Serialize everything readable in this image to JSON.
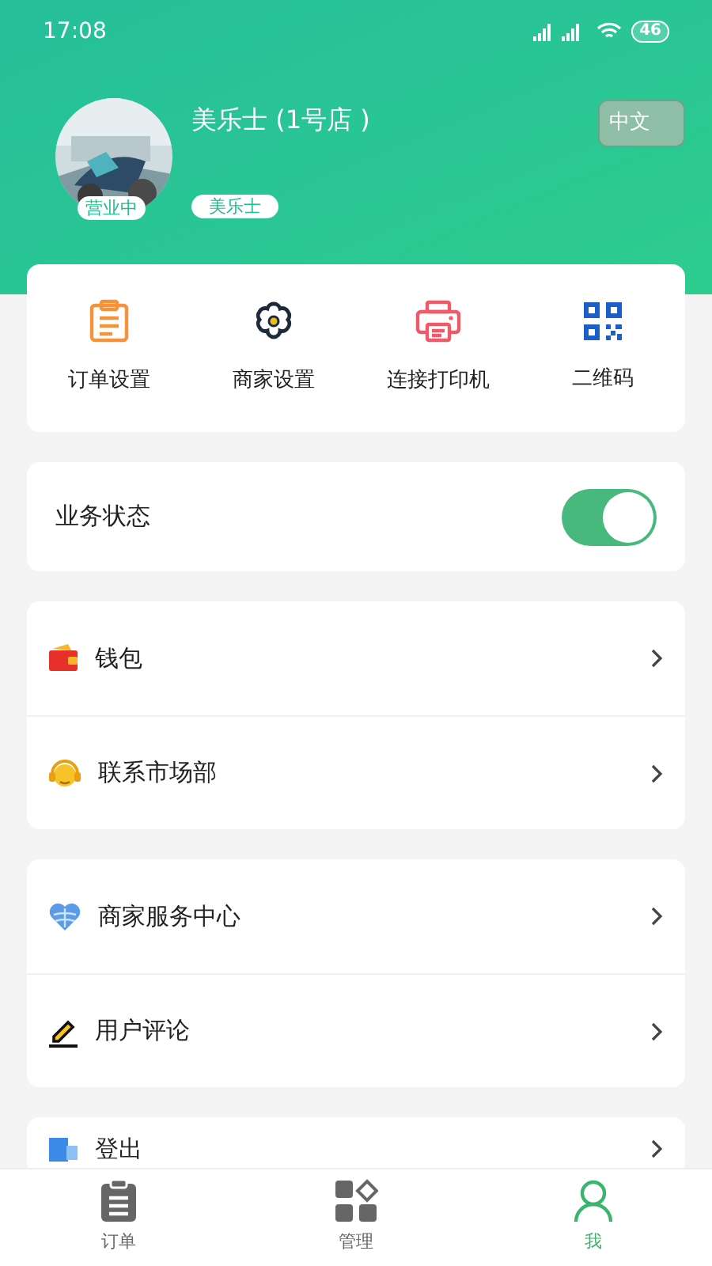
{
  "status_bar": {
    "time": "17:08",
    "battery": "46"
  },
  "profile": {
    "name": "美乐士 (1号店 )",
    "status_badge": "营业中",
    "tag": "美乐士",
    "language_button": "中文"
  },
  "shortcuts": [
    {
      "label": "订单设置"
    },
    {
      "label": "商家设置"
    },
    {
      "label": "连接打印机"
    },
    {
      "label": "二维码"
    }
  ],
  "business_status": {
    "label": "业务状态",
    "on": true
  },
  "menu_groups": [
    [
      {
        "label": "钱包"
      },
      {
        "label": "联系市场部"
      }
    ],
    [
      {
        "label": "商家服务中心"
      },
      {
        "label": "用户评论"
      }
    ],
    [
      {
        "label": "登出"
      }
    ]
  ],
  "tab_bar": [
    {
      "label": "订单",
      "selected": false
    },
    {
      "label": "管理",
      "selected": false
    },
    {
      "label": "我",
      "selected": true
    }
  ]
}
